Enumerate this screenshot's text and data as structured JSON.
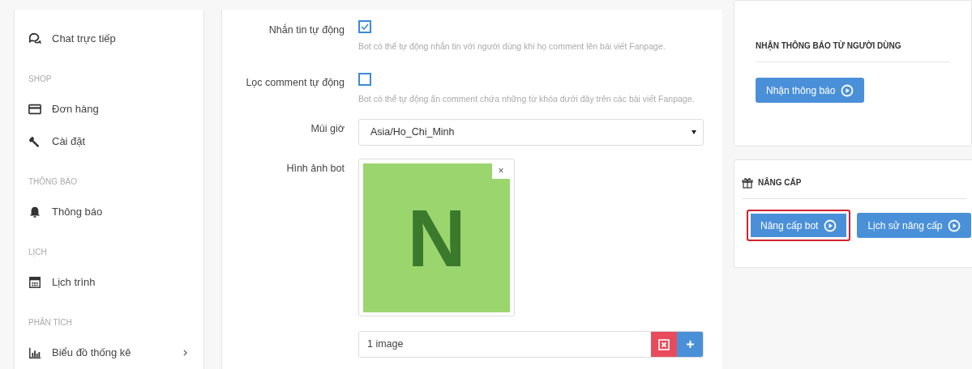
{
  "sidebar": {
    "sections": [
      {
        "items": [
          {
            "label": "Chat trực tiếp",
            "submenu": false
          }
        ]
      },
      {
        "title": "SHOP",
        "items": [
          {
            "label": "Đơn hàng",
            "submenu": false
          },
          {
            "label": "Cài đặt",
            "submenu": false
          }
        ]
      },
      {
        "title": "THÔNG BÁO",
        "items": [
          {
            "label": "Thông báo",
            "submenu": false
          }
        ]
      },
      {
        "title": "LỊCH",
        "items": [
          {
            "label": "Lịch trình",
            "submenu": false
          }
        ]
      },
      {
        "title": "PHÂN TÍCH",
        "items": [
          {
            "label": "Biểu đồ thống kê",
            "submenu": true
          }
        ]
      }
    ]
  },
  "form": {
    "fields": [
      {
        "kind": "checkbox",
        "label": "Nhắn tin tự động",
        "checked": true,
        "help": "Bot có thể tự động nhắn tin với người dùng khi họ comment lên bài viết Fanpage."
      },
      {
        "kind": "checkbox",
        "label": "Lọc comment tự động",
        "checked": false,
        "help": "Bot có thể tự động ẩn comment chứa những từ khóa dưới đây trên các bài viết Fanpage."
      },
      {
        "kind": "select",
        "label": "Múi giờ",
        "value": "Asia/Ho_Chi_Minh"
      },
      {
        "kind": "image",
        "label": "Hình ảnh bot",
        "avatar_letter": "N",
        "remove": "×",
        "count": "1 image"
      }
    ]
  },
  "panels": [
    {
      "kind": "notify",
      "title": "NHẬN THÔNG BÁO TỪ NGƯỜI DÙNG",
      "buttons": [
        {
          "label": "Nhận thông báo",
          "highlighted": false
        }
      ]
    },
    {
      "kind": "upgrade",
      "title": "NÂNG CẤP",
      "buttons": [
        {
          "label": "Nâng cấp bot",
          "highlighted": true
        },
        {
          "label": "Lịch sử nâng cấp",
          "highlighted": false
        }
      ]
    }
  ]
}
